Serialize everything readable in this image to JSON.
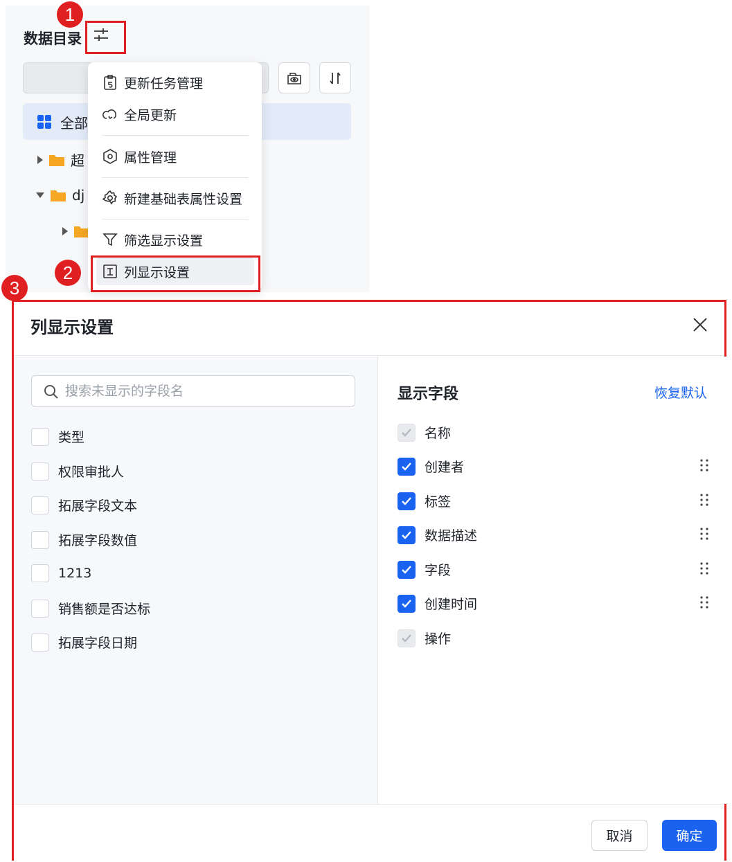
{
  "catalog": {
    "title": "数据目录",
    "tree_all_label": "全部",
    "tree_items": [
      {
        "label": "超"
      },
      {
        "label": "dj"
      }
    ]
  },
  "menu": {
    "items": [
      {
        "label": "更新任务管理",
        "icon": "clipboard-update-icon"
      },
      {
        "label": "全局更新",
        "icon": "cloud-refresh-icon"
      },
      {
        "label": "属性管理",
        "icon": "hexagon-settings-icon"
      },
      {
        "label": "新建基础表属性设置",
        "icon": "gear-icon"
      },
      {
        "label": "筛选显示设置",
        "icon": "filter-icon"
      },
      {
        "label": "列显示设置",
        "icon": "column-display-icon"
      }
    ]
  },
  "markers": [
    "1",
    "2",
    "3"
  ],
  "dialog": {
    "title": "列显示设置",
    "search_placeholder": "搜索未显示的字段名",
    "hidden_fields": [
      {
        "label": "类型",
        "checked": false
      },
      {
        "label": "权限审批人",
        "checked": false
      },
      {
        "label": "拓展字段文本",
        "checked": false
      },
      {
        "label": "拓展字段数值",
        "checked": false
      },
      {
        "label": "1213",
        "checked": false
      },
      {
        "label": "销售额是否达标",
        "checked": false
      },
      {
        "label": "拓展字段日期",
        "checked": false
      }
    ],
    "shown_title": "显示字段",
    "restore_label": "恢复默认",
    "shown_fields": [
      {
        "label": "名称",
        "state": "disabled"
      },
      {
        "label": "创建者",
        "state": "checked"
      },
      {
        "label": "标签",
        "state": "checked"
      },
      {
        "label": "数据描述",
        "state": "checked"
      },
      {
        "label": "字段",
        "state": "checked"
      },
      {
        "label": "创建时间",
        "state": "checked"
      },
      {
        "label": "操作",
        "state": "disabled"
      }
    ],
    "cancel_label": "取消",
    "ok_label": "确定"
  },
  "colors": {
    "primary": "#1a63f0",
    "annotation": "#e02020"
  }
}
